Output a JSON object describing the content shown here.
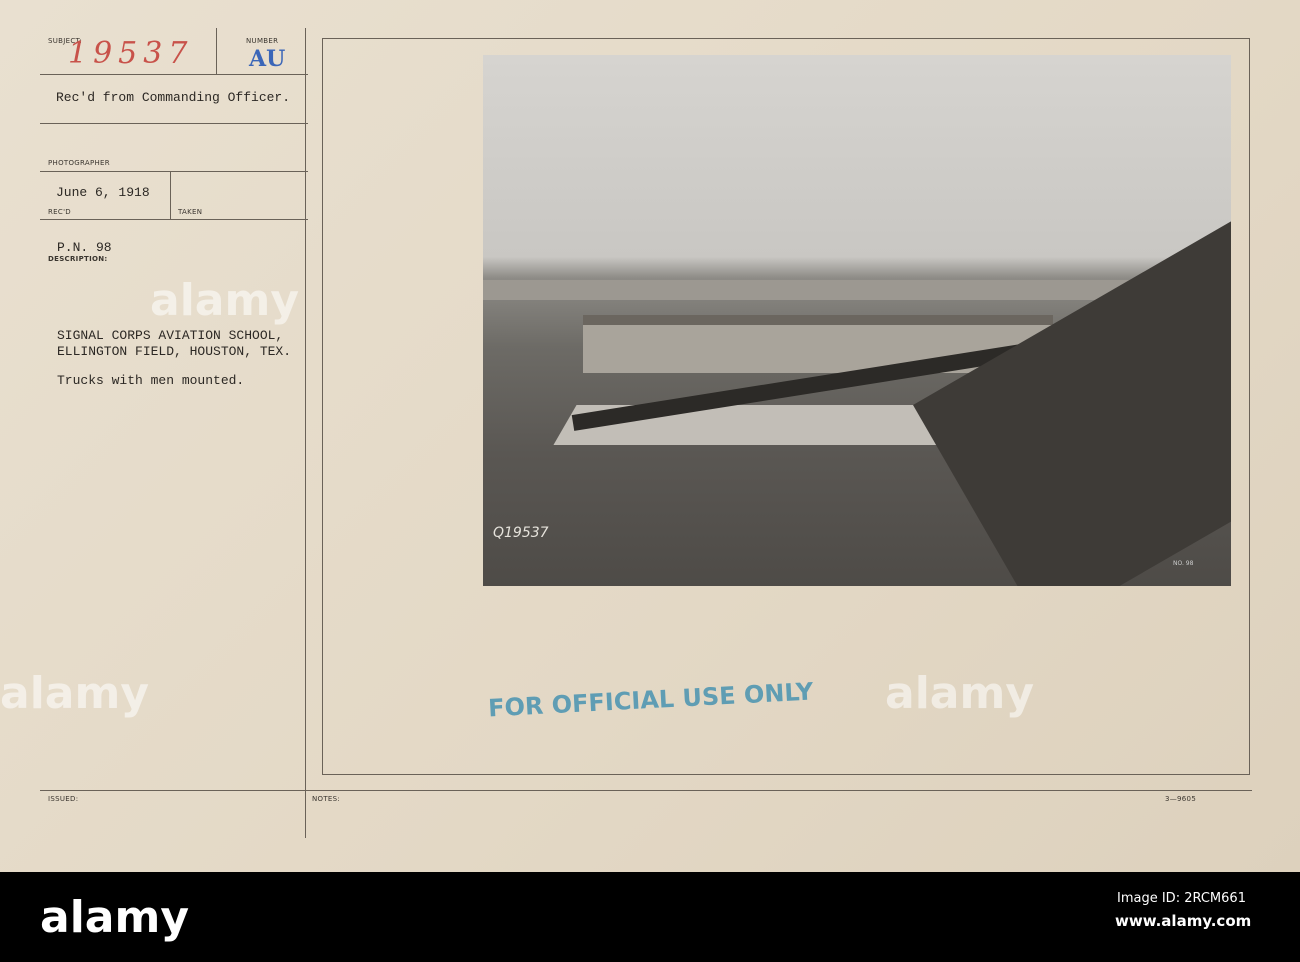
{
  "card": {
    "subject_label": "SUBJECT:",
    "subject_value": "19537",
    "number_label": "NUMBER",
    "number_value": "AU",
    "received_from": "Rec'd from Commanding Officer.",
    "photographer_label": "PHOTOGRAPHER",
    "date": "June 6, 1918",
    "recd_label": "REC'D",
    "taken_label": "TAKEN",
    "pn": "P.N. 98",
    "description_label": "DESCRIPTION:",
    "description_line1": "SIGNAL CORPS AVIATION SCHOOL,",
    "description_line2": "ELLINGTON FIELD, HOUSTON, TEX.",
    "caption": "Trucks with men mounted.",
    "issued_label": "ISSUED:",
    "notes_label": "NOTES:",
    "form_number": "3—9605",
    "stamp": "FOR OFFICIAL USE ONLY",
    "stamp_color": "#3f8fb0",
    "photo_number": "Q19537",
    "photo_neg": "NO. 98"
  },
  "watermark": "alamy",
  "footer": {
    "brand": "alamy",
    "image_id": "Image ID: 2RCM661",
    "url": "www.alamy.com"
  }
}
